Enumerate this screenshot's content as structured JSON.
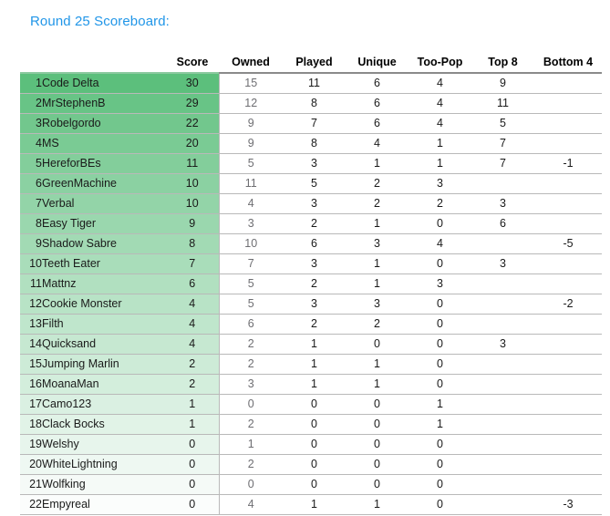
{
  "title": "Round 25 Scoreboard:",
  "theme": {
    "title_color": "#2196e8",
    "highlight_top": "#5cbf7c",
    "highlight_bottom": "#fbfdfc",
    "grid_color": "#b9b9b9",
    "owned_text_color": "#6e6e72"
  },
  "table": {
    "columns": [
      {
        "key": "rank",
        "label": ""
      },
      {
        "key": "player",
        "label": ""
      },
      {
        "key": "score",
        "label": "Score"
      },
      {
        "key": "owned",
        "label": "Owned"
      },
      {
        "key": "played",
        "label": "Played"
      },
      {
        "key": "unique",
        "label": "Unique"
      },
      {
        "key": "toopop",
        "label": "Too-Pop"
      },
      {
        "key": "top8",
        "label": "Top 8"
      },
      {
        "key": "bot4",
        "label": "Bottom 4"
      }
    ],
    "rows": [
      {
        "rank": "1",
        "player": "Code Delta",
        "score": "30",
        "owned": "15",
        "played": "11",
        "unique": "6",
        "toopop": "4",
        "top8": "9",
        "bot4": ""
      },
      {
        "rank": "2",
        "player": "MrStephenB",
        "score": "29",
        "owned": "12",
        "played": "8",
        "unique": "6",
        "toopop": "4",
        "top8": "11",
        "bot4": ""
      },
      {
        "rank": "3",
        "player": "Robelgordo",
        "score": "22",
        "owned": "9",
        "played": "7",
        "unique": "6",
        "toopop": "4",
        "top8": "5",
        "bot4": ""
      },
      {
        "rank": "4",
        "player": "MS",
        "score": "20",
        "owned": "9",
        "played": "8",
        "unique": "4",
        "toopop": "1",
        "top8": "7",
        "bot4": ""
      },
      {
        "rank": "5",
        "player": "HereforBEs",
        "score": "11",
        "owned": "5",
        "played": "3",
        "unique": "1",
        "toopop": "1",
        "top8": "7",
        "bot4": "-1"
      },
      {
        "rank": "6",
        "player": "GreenMachine",
        "score": "10",
        "owned": "11",
        "played": "5",
        "unique": "2",
        "toopop": "3",
        "top8": "",
        "bot4": ""
      },
      {
        "rank": "7",
        "player": "Verbal",
        "score": "10",
        "owned": "4",
        "played": "3",
        "unique": "2",
        "toopop": "2",
        "top8": "3",
        "bot4": ""
      },
      {
        "rank": "8",
        "player": "Easy Tiger",
        "score": "9",
        "owned": "3",
        "played": "2",
        "unique": "1",
        "toopop": "0",
        "top8": "6",
        "bot4": ""
      },
      {
        "rank": "9",
        "player": "Shadow Sabre",
        "score": "8",
        "owned": "10",
        "played": "6",
        "unique": "3",
        "toopop": "4",
        "top8": "",
        "bot4": "-5"
      },
      {
        "rank": "10",
        "player": "Teeth Eater",
        "score": "7",
        "owned": "7",
        "played": "3",
        "unique": "1",
        "toopop": "0",
        "top8": "3",
        "bot4": ""
      },
      {
        "rank": "11",
        "player": "Mattnz",
        "score": "6",
        "owned": "5",
        "played": "2",
        "unique": "1",
        "toopop": "3",
        "top8": "",
        "bot4": ""
      },
      {
        "rank": "12",
        "player": "Cookie Monster",
        "score": "4",
        "owned": "5",
        "played": "3",
        "unique": "3",
        "toopop": "0",
        "top8": "",
        "bot4": "-2"
      },
      {
        "rank": "13",
        "player": "Filth",
        "score": "4",
        "owned": "6",
        "played": "2",
        "unique": "2",
        "toopop": "0",
        "top8": "",
        "bot4": ""
      },
      {
        "rank": "14",
        "player": "Quicksand",
        "score": "4",
        "owned": "2",
        "played": "1",
        "unique": "0",
        "toopop": "0",
        "top8": "3",
        "bot4": ""
      },
      {
        "rank": "15",
        "player": "Jumping Marlin",
        "score": "2",
        "owned": "2",
        "played": "1",
        "unique": "1",
        "toopop": "0",
        "top8": "",
        "bot4": ""
      },
      {
        "rank": "16",
        "player": "MoanaMan",
        "score": "2",
        "owned": "3",
        "played": "1",
        "unique": "1",
        "toopop": "0",
        "top8": "",
        "bot4": ""
      },
      {
        "rank": "17",
        "player": "Camo123",
        "score": "1",
        "owned": "0",
        "played": "0",
        "unique": "0",
        "toopop": "1",
        "top8": "",
        "bot4": ""
      },
      {
        "rank": "18",
        "player": "Clack Bocks",
        "score": "1",
        "owned": "2",
        "played": "0",
        "unique": "0",
        "toopop": "1",
        "top8": "",
        "bot4": ""
      },
      {
        "rank": "19",
        "player": "Welshy",
        "score": "0",
        "owned": "1",
        "played": "0",
        "unique": "0",
        "toopop": "0",
        "top8": "",
        "bot4": ""
      },
      {
        "rank": "20",
        "player": "WhiteLightning",
        "score": "0",
        "owned": "2",
        "played": "0",
        "unique": "0",
        "toopop": "0",
        "top8": "",
        "bot4": ""
      },
      {
        "rank": "21",
        "player": "Wolfking",
        "score": "0",
        "owned": "0",
        "played": "0",
        "unique": "0",
        "toopop": "0",
        "top8": "",
        "bot4": ""
      },
      {
        "rank": "22",
        "player": "Empyreal",
        "score": "0",
        "owned": "4",
        "played": "1",
        "unique": "1",
        "toopop": "0",
        "top8": "",
        "bot4": "-3"
      }
    ]
  }
}
